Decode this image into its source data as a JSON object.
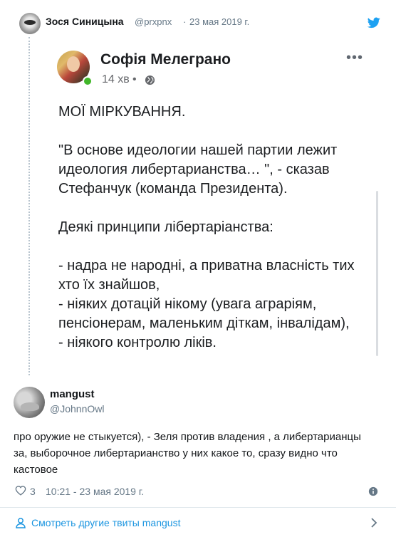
{
  "parent_tweet": {
    "author_name": "Зося Синицына",
    "handle": "@prxpnx",
    "separator": "·",
    "date": "23 мая 2019 г."
  },
  "embedded_post": {
    "author_name": "Софія Мелеграно",
    "time": "14 хв",
    "dot": "•",
    "more": "•••",
    "text": "МОЇ МІРКУВАННЯ.\n\n\"В основе идеологии нашей партии лежит идеология либертарианства… \", - сказав Стефанчук (команда Президента).\n\nДеякі принципи лібертаріанства:\n\n- надра не народні, а приватна власність тих хто їх знайшов,\n- ніяких дотацій нікому (увага аграріям, пенсіонерам, маленьким діткам, інвалідам),\n- ніякого контролю ліків."
  },
  "reply": {
    "author_name": "mangust",
    "handle": "@JohnnOwl",
    "text": "про оружие не стыкуется), - Зеля против владения , а либертарианцы за, выборочное либертарианство у них какое то, сразу видно что кастовое",
    "like_count": "3",
    "time": "10:21 - 23 мая 2019 г."
  },
  "footer": {
    "more_tweets_label": "Смотреть другие твиты mangust"
  },
  "colors": {
    "twitter_blue": "#1da1f2",
    "link_blue": "#1b95e0",
    "secondary_text": "#657786",
    "online_green": "#42b72a"
  }
}
